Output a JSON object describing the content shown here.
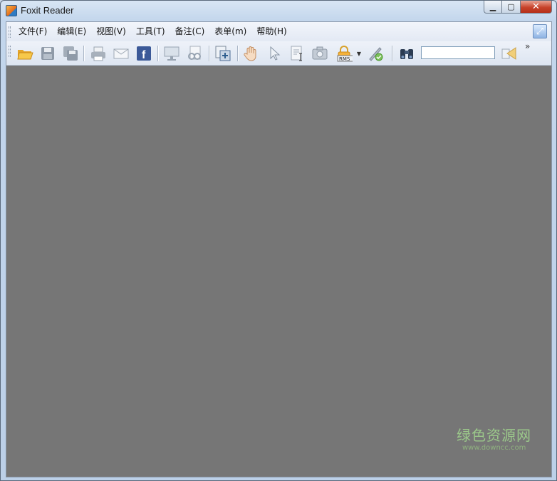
{
  "window": {
    "title": "Foxit Reader",
    "controls": {
      "minimize": "▁",
      "maximize": "▢",
      "close": "✕"
    }
  },
  "menu": {
    "items": [
      {
        "label": "文件(F)"
      },
      {
        "label": "编辑(E)"
      },
      {
        "label": "视图(V)"
      },
      {
        "label": "工具(T)"
      },
      {
        "label": "备注(C)"
      },
      {
        "label": "表单(m)"
      },
      {
        "label": "帮助(H)"
      }
    ]
  },
  "toolbar": {
    "icons": [
      "open-folder-icon",
      "save-icon",
      "save-as-icon",
      "print-icon",
      "email-icon",
      "facebook-icon",
      "presentation-icon",
      "read-mode-icon",
      "fit-page-icon",
      "hand-tool-icon",
      "select-tool-icon",
      "text-select-icon",
      "snapshot-icon",
      "rms-lock-icon",
      "sign-icon",
      "find-binoculars-icon",
      "speaker-icon"
    ],
    "search_value": "",
    "rms_label": "RMS",
    "facebook_label": "f",
    "more_label": "»"
  },
  "watermark": {
    "line1": "绿色资源网",
    "line2": "www.downcc.com"
  },
  "colors": {
    "canvas": "#767676",
    "menubar": "#e8edf6",
    "accent": "#f4b13a"
  }
}
